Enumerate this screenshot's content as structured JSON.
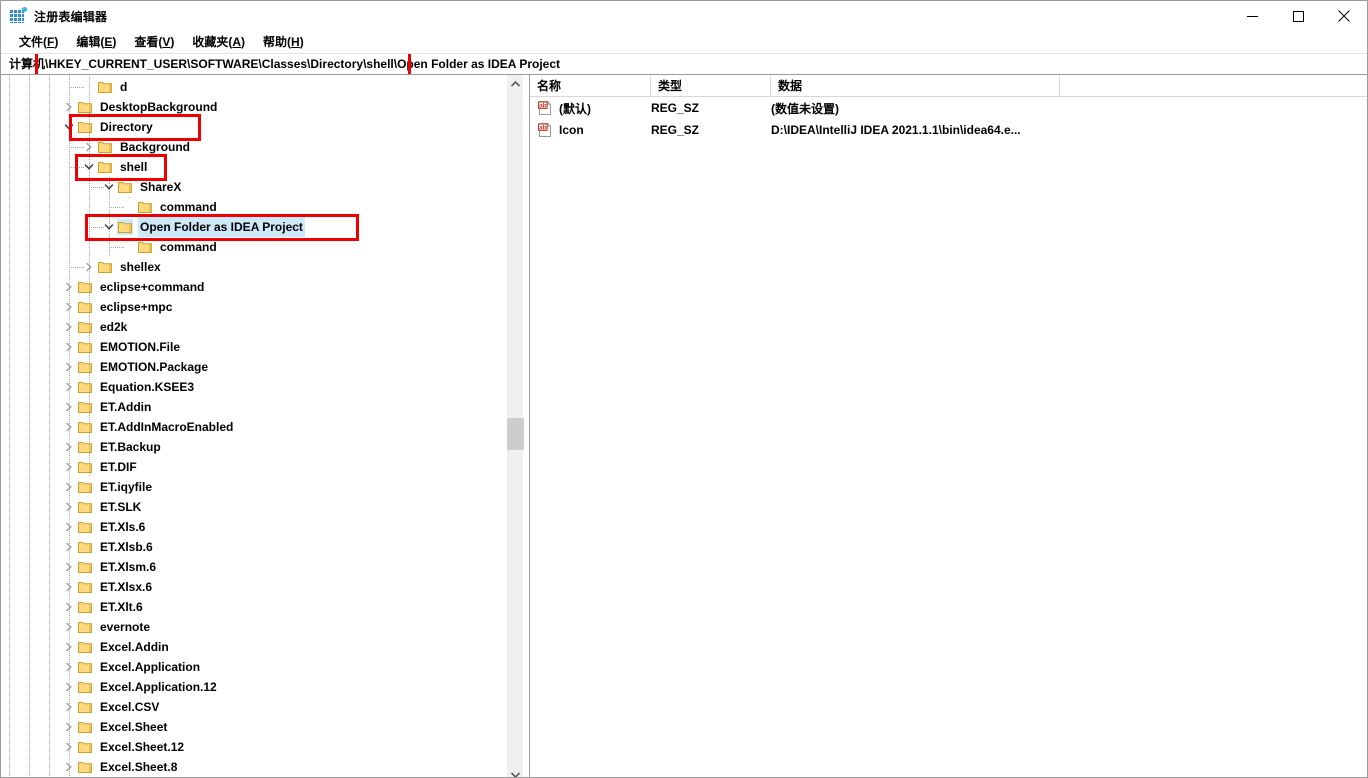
{
  "window": {
    "title": "注册表编辑器",
    "icon": "registry-editor-icon",
    "controls": {
      "minimize": "minimize-icon",
      "maximize": "maximize-icon",
      "close": "close-icon"
    }
  },
  "menubar": {
    "items": [
      {
        "label": "文件(F)",
        "text": "文件(",
        "mnemonic": "F",
        "tail": ")"
      },
      {
        "label": "编辑(E)",
        "text": "编辑(",
        "mnemonic": "E",
        "tail": ")"
      },
      {
        "label": "查看(V)",
        "text": "查看(",
        "mnemonic": "V",
        "tail": ")"
      },
      {
        "label": "收藏夹(A)",
        "text": "收藏夹(",
        "mnemonic": "A",
        "tail": ")"
      },
      {
        "label": "帮助(H)",
        "text": "帮助(",
        "mnemonic": "H",
        "tail": ")"
      }
    ]
  },
  "address": {
    "value": "计算机\\HKEY_CURRENT_USER\\SOFTWARE\\Classes\\Directory\\shell\\Open Folder as IDEA Project",
    "highlight_color": "#f00000"
  },
  "tree": {
    "scrollbar": {
      "up_arrow": "chevron-up-icon",
      "down_arrow": "chevron-down-icon"
    },
    "nodes": [
      {
        "label": "d",
        "depth": 4,
        "state": "leaf"
      },
      {
        "label": "DesktopBackground",
        "depth": 3,
        "state": "collapsed"
      },
      {
        "label": "Directory",
        "depth": 3,
        "state": "expanded",
        "annotated": true
      },
      {
        "label": "Background",
        "depth": 4,
        "state": "collapsed"
      },
      {
        "label": "shell",
        "depth": 4,
        "state": "expanded",
        "annotated": true
      },
      {
        "label": "ShareX",
        "depth": 5,
        "state": "expanded"
      },
      {
        "label": "command",
        "depth": 6,
        "state": "leaf"
      },
      {
        "label": "Open Folder as IDEA Project",
        "depth": 5,
        "state": "expanded",
        "selected": true,
        "annotated": true
      },
      {
        "label": "command",
        "depth": 6,
        "state": "leaf"
      },
      {
        "label": "shellex",
        "depth": 4,
        "state": "collapsed"
      },
      {
        "label": "eclipse+command",
        "depth": 3,
        "state": "collapsed"
      },
      {
        "label": "eclipse+mpc",
        "depth": 3,
        "state": "collapsed"
      },
      {
        "label": "ed2k",
        "depth": 3,
        "state": "collapsed"
      },
      {
        "label": "EMOTION.File",
        "depth": 3,
        "state": "collapsed"
      },
      {
        "label": "EMOTION.Package",
        "depth": 3,
        "state": "collapsed"
      },
      {
        "label": "Equation.KSEE3",
        "depth": 3,
        "state": "collapsed"
      },
      {
        "label": "ET.Addin",
        "depth": 3,
        "state": "collapsed"
      },
      {
        "label": "ET.AddInMacroEnabled",
        "depth": 3,
        "state": "collapsed"
      },
      {
        "label": "ET.Backup",
        "depth": 3,
        "state": "collapsed"
      },
      {
        "label": "ET.DIF",
        "depth": 3,
        "state": "collapsed"
      },
      {
        "label": "ET.iqyfile",
        "depth": 3,
        "state": "collapsed"
      },
      {
        "label": "ET.SLK",
        "depth": 3,
        "state": "collapsed"
      },
      {
        "label": "ET.Xls.6",
        "depth": 3,
        "state": "collapsed"
      },
      {
        "label": "ET.Xlsb.6",
        "depth": 3,
        "state": "collapsed"
      },
      {
        "label": "ET.Xlsm.6",
        "depth": 3,
        "state": "collapsed"
      },
      {
        "label": "ET.Xlsx.6",
        "depth": 3,
        "state": "collapsed"
      },
      {
        "label": "ET.Xlt.6",
        "depth": 3,
        "state": "collapsed"
      },
      {
        "label": "evernote",
        "depth": 3,
        "state": "collapsed"
      },
      {
        "label": "Excel.Addin",
        "depth": 3,
        "state": "collapsed"
      },
      {
        "label": "Excel.Application",
        "depth": 3,
        "state": "collapsed"
      },
      {
        "label": "Excel.Application.12",
        "depth": 3,
        "state": "collapsed"
      },
      {
        "label": "Excel.CSV",
        "depth": 3,
        "state": "collapsed"
      },
      {
        "label": "Excel.Sheet",
        "depth": 3,
        "state": "collapsed"
      },
      {
        "label": "Excel.Sheet.12",
        "depth": 3,
        "state": "collapsed"
      },
      {
        "label": "Excel.Sheet.8",
        "depth": 3,
        "state": "collapsed"
      }
    ]
  },
  "values": {
    "columns": [
      "名称",
      "类型",
      "数据"
    ],
    "rows": [
      {
        "icon": "string-value-icon",
        "name": "(默认)",
        "type": "REG_SZ",
        "data": "(数值未设置)"
      },
      {
        "icon": "string-value-icon",
        "name": "Icon",
        "type": "REG_SZ",
        "data": "D:\\IDEA\\IntelliJ IDEA 2021.1.1\\bin\\idea64.e..."
      }
    ]
  },
  "colors": {
    "annotation": "#f00000",
    "selection": "#cde8f9",
    "folder": "#ffd97f",
    "scrollbar_thumb": "#cdcdcd"
  }
}
